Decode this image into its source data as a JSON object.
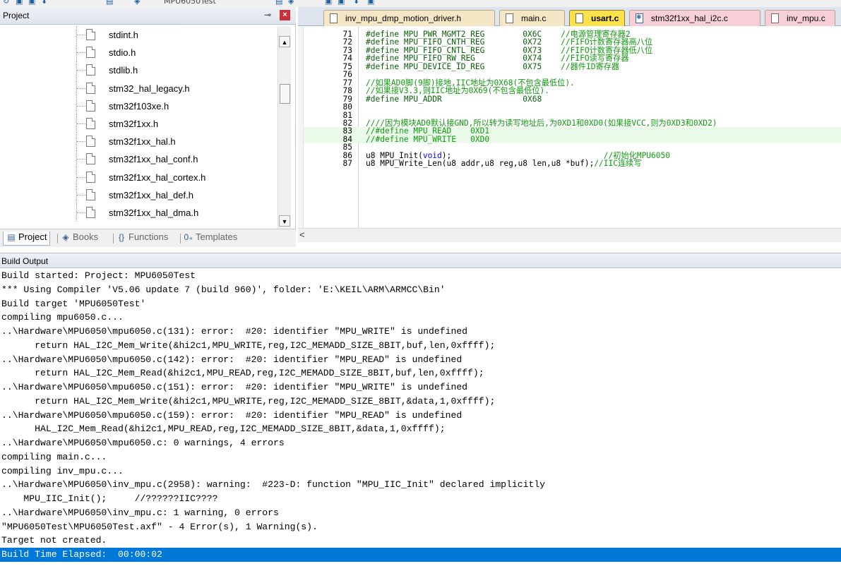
{
  "toolbar": {
    "target_name": "MPU6050Test"
  },
  "project_panel": {
    "title": "Project",
    "files": [
      "stdint.h",
      "stdio.h",
      "stdlib.h",
      "stm32_hal_legacy.h",
      "stm32f103xe.h",
      "stm32f1xx.h",
      "stm32f1xx_hal.h",
      "stm32f1xx_hal_conf.h",
      "stm32f1xx_hal_cortex.h",
      "stm32f1xx_hal_def.h",
      "stm32f1xx_hal_dma.h"
    ],
    "tabs": [
      {
        "label": "Project",
        "icon": "project-icon",
        "active": true
      },
      {
        "label": "Books",
        "icon": "books-icon",
        "active": false
      },
      {
        "label": "Functions",
        "icon": "functions-icon",
        "active": false
      },
      {
        "label": "Templates",
        "icon": "templates-icon",
        "active": false
      }
    ]
  },
  "editor": {
    "tabs": [
      {
        "label": "inv_mpu_dmp_motion_driver.h",
        "color": "#f5e6c6",
        "active": false
      },
      {
        "label": "main.c",
        "color": "#f5e6c6",
        "active": false
      },
      {
        "label": "usart.c",
        "color": "#fbe24a",
        "active": true
      },
      {
        "label": "stm32f1xx_hal_i2c.c",
        "color": "#f7cfd6",
        "active": false
      },
      {
        "label": "inv_mpu.c",
        "color": "#f7cfd6",
        "active": false
      }
    ],
    "lines": [
      {
        "num": "71",
        "segs": [
          {
            "c": "pp",
            "t": "#define MPU_PWR_MGMT2_REG        0X6C    "
          },
          {
            "c": "cm",
            "t": "//电源管理寄存器2"
          }
        ]
      },
      {
        "num": "72",
        "segs": [
          {
            "c": "pp",
            "t": "#define MPU_FIFO_CNTH_REG        0X72    "
          },
          {
            "c": "cm",
            "t": "//FIFO计数寄存器高八位"
          }
        ]
      },
      {
        "num": "73",
        "segs": [
          {
            "c": "pp",
            "t": "#define MPU_FIFO_CNTL_REG        0X73    "
          },
          {
            "c": "cm",
            "t": "//FIFO计数寄存器低八位"
          }
        ]
      },
      {
        "num": "74",
        "segs": [
          {
            "c": "pp",
            "t": "#define MPU_FIFO_RW_REG          0X74    "
          },
          {
            "c": "cm",
            "t": "//FIFO读写寄存器"
          }
        ]
      },
      {
        "num": "75",
        "segs": [
          {
            "c": "pp",
            "t": "#define MPU_DEVICE_ID_REG        0X75    "
          },
          {
            "c": "cm",
            "t": "//器件ID寄存器"
          }
        ]
      },
      {
        "num": "76",
        "segs": []
      },
      {
        "num": "77",
        "segs": [
          {
            "c": "cm",
            "t": "//如果AD0脚(9脚)接地,IIC地址为0X68(不包含最低位)."
          }
        ]
      },
      {
        "num": "78",
        "segs": [
          {
            "c": "cm",
            "t": "//如果接V3.3,则IIC地址为0X69(不包含最低位)."
          }
        ]
      },
      {
        "num": "79",
        "segs": [
          {
            "c": "pp",
            "t": "#define MPU_ADDR                 0X68"
          }
        ]
      },
      {
        "num": "80",
        "segs": []
      },
      {
        "num": "81",
        "segs": []
      },
      {
        "num": "82",
        "segs": [
          {
            "c": "cm",
            "t": "////因为模块AD0默认接GND,所以转为读写地址后,为0XD1和0XD0(如果接VCC,则为0XD3和0XD2)"
          }
        ]
      },
      {
        "num": "83",
        "hl": true,
        "segs": [
          {
            "c": "cm",
            "t": "//#define MPU_READ    0XD1"
          }
        ]
      },
      {
        "num": "84",
        "hl": true,
        "segs": [
          {
            "c": "cm",
            "t": "//#define MPU_WRITE   0XD0"
          }
        ]
      },
      {
        "num": "85",
        "segs": []
      },
      {
        "num": "86",
        "segs": [
          {
            "c": "",
            "t": "u8 MPU_Init("
          },
          {
            "c": "kw",
            "t": "void"
          },
          {
            "c": "",
            "t": ");                                "
          },
          {
            "c": "cm",
            "t": "//初始化MPU6050"
          }
        ]
      },
      {
        "num": "87",
        "segs": [
          {
            "c": "",
            "t": "u8 MPU_Write_Len(u8 addr,u8 reg,u8 len,u8 *buf);"
          },
          {
            "c": "cm",
            "t": "//IIC连续写"
          }
        ]
      }
    ]
  },
  "build_output": {
    "title": "Build Output",
    "lines": [
      "Build started: Project: MPU6050Test",
      "*** Using Compiler 'V5.06 update 7 (build 960)', folder: 'E:\\KEIL\\ARM\\ARMCC\\Bin'",
      "Build target 'MPU6050Test'",
      "compiling mpu6050.c...",
      "..\\Hardware\\MPU6050\\mpu6050.c(131): error:  #20: identifier \"MPU_WRITE\" is undefined",
      "      return HAL_I2C_Mem_Write(&hi2c1,MPU_WRITE,reg,I2C_MEMADD_SIZE_8BIT,buf,len,0xffff);",
      "..\\Hardware\\MPU6050\\mpu6050.c(142): error:  #20: identifier \"MPU_READ\" is undefined",
      "      return HAL_I2C_Mem_Read(&hi2c1,MPU_READ,reg,I2C_MEMADD_SIZE_8BIT,buf,len,0xffff);",
      "..\\Hardware\\MPU6050\\mpu6050.c(151): error:  #20: identifier \"MPU_WRITE\" is undefined",
      "      return HAL_I2C_Mem_Write(&hi2c1,MPU_WRITE,reg,I2C_MEMADD_SIZE_8BIT,&data,1,0xffff);",
      "..\\Hardware\\MPU6050\\mpu6050.c(159): error:  #20: identifier \"MPU_READ\" is undefined",
      "      HAL_I2C_Mem_Read(&hi2c1,MPU_READ,reg,I2C_MEMADD_SIZE_8BIT,&data,1,0xffff);",
      "..\\Hardware\\MPU6050\\mpu6050.c: 0 warnings, 4 errors",
      "compiling main.c...",
      "compiling inv_mpu.c...",
      "..\\Hardware\\MPU6050\\inv_mpu.c(2958): warning:  #223-D: function \"MPU_IIC_Init\" declared implicitly",
      "    MPU_IIC_Init();     //??????IIC????",
      "..\\Hardware\\MPU6050\\inv_mpu.c: 1 warning, 0 errors",
      "\"MPU6050Test\\MPU6050Test.axf\" - 4 Error(s), 1 Warning(s).",
      "Target not created.",
      "Build Time Elapsed:  00:00:02"
    ],
    "selected_index": 20
  }
}
